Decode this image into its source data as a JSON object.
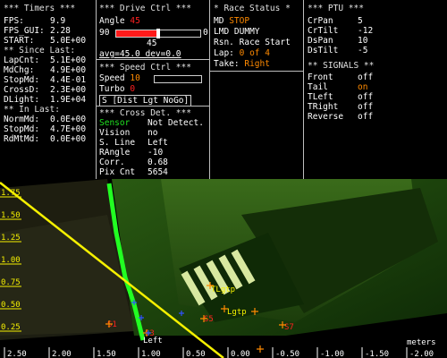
{
  "timers": {
    "header": "*** Timers ***",
    "rows": [
      {
        "label": "FPS:",
        "value": "9.9"
      },
      {
        "label": "FPS_GUI:",
        "value": "2.28"
      },
      {
        "label": "START:",
        "value": "5.0E+00"
      }
    ],
    "since_header": "** Since Last:",
    "since_rows": [
      {
        "label": "LapCnt:",
        "value": "5.1E+00"
      },
      {
        "label": "MdChg:",
        "value": "4.9E+00"
      },
      {
        "label": "StopMd:",
        "value": "4.4E-01"
      },
      {
        "label": "CrossD:",
        "value": "2.3E+00"
      },
      {
        "label": "DLight:",
        "value": "1.9E+04"
      }
    ],
    "inlast_header": "** In Last:",
    "inlast_rows": [
      {
        "label": "NormMd:",
        "value": "0.0E+00"
      },
      {
        "label": "StopMd:",
        "value": "4.7E+00"
      },
      {
        "label": "RdMtMd:",
        "value": "0.0E+00"
      }
    ]
  },
  "drive": {
    "header": "*** Drive Ctrl  ***",
    "angle_label": "Angle",
    "angle_value": "45",
    "slider_min": "90",
    "slider_max": "0",
    "slider_fraction": 0.5,
    "slider_under": "45",
    "avg_text": "avg=45.0  dev=0.0",
    "speed_header": "*** Speed Ctrl ***",
    "speed_label": "Speed",
    "speed_value": "10",
    "turbo_label": "Turbo",
    "turbo_value": "0",
    "sbox_text": "S [Dist Lgt NoGo]"
  },
  "cross": {
    "header": "*** Cross Det. ***",
    "rows": [
      {
        "label": "Sensor",
        "value": "Not Detect."
      },
      {
        "label": "Vision",
        "value": "no"
      },
      {
        "label": "S. Line",
        "value": "Left"
      },
      {
        "label": "RAngle",
        "value": "-10"
      },
      {
        "label": "Corr.",
        "value": "0.68"
      },
      {
        "label": "Pix Cnt",
        "value": "5654"
      }
    ]
  },
  "race": {
    "header": "* Race Status *",
    "md_label": "MD",
    "md_value": "STOP",
    "lmd_label": "LMD",
    "lmd_value": "DUMMY",
    "rsn_label": "Rsn.",
    "rsn_value": "Race Start",
    "lap_label": "Lap:",
    "lap_value": "0 of 4",
    "take_label": "Take:",
    "take_value": "Right"
  },
  "ptu": {
    "header": "*** PTU ***",
    "rows": [
      {
        "label": "CrPan",
        "value": "5"
      },
      {
        "label": "CrTilt",
        "value": "-12"
      },
      {
        "label": "DsPan",
        "value": "10"
      },
      {
        "label": "DsTilt",
        "value": "-5"
      }
    ],
    "signals_header": "** SIGNALS **",
    "signals": [
      {
        "label": "Front",
        "value": "off",
        "on": false
      },
      {
        "label": "Tail",
        "value": "on",
        "on": true
      },
      {
        "label": "TLeft",
        "value": "off",
        "on": false
      },
      {
        "label": "TRight",
        "value": "off",
        "on": false
      },
      {
        "label": "Reverse",
        "value": "off",
        "on": false
      }
    ]
  },
  "camera": {
    "y_ticks": [
      "1.75",
      "1.50",
      "1.25",
      "1.00",
      "0.75",
      "0.50",
      "0.25"
    ],
    "x_ticks": [
      "2.50",
      "2.00",
      "1.50",
      "1.00",
      "0.50",
      "0.00",
      "-0.50",
      "-1.00",
      "-1.50",
      "-2.00"
    ],
    "units": "meters",
    "markers": {
      "tlgtp": "TLgtp",
      "lgtp": "Lgtp",
      "s1": "S1",
      "s3": "S3",
      "s5": "S5",
      "s7": "S7",
      "left": "Left"
    }
  },
  "colors": {
    "header": "#d8d8d8",
    "label": "#ffffff",
    "value": "#ffffff",
    "red": "#ff2020",
    "orange": "#ff8a00",
    "green": "#20e020",
    "yellow": "#f5f000",
    "cyan": "#40c0ff"
  }
}
